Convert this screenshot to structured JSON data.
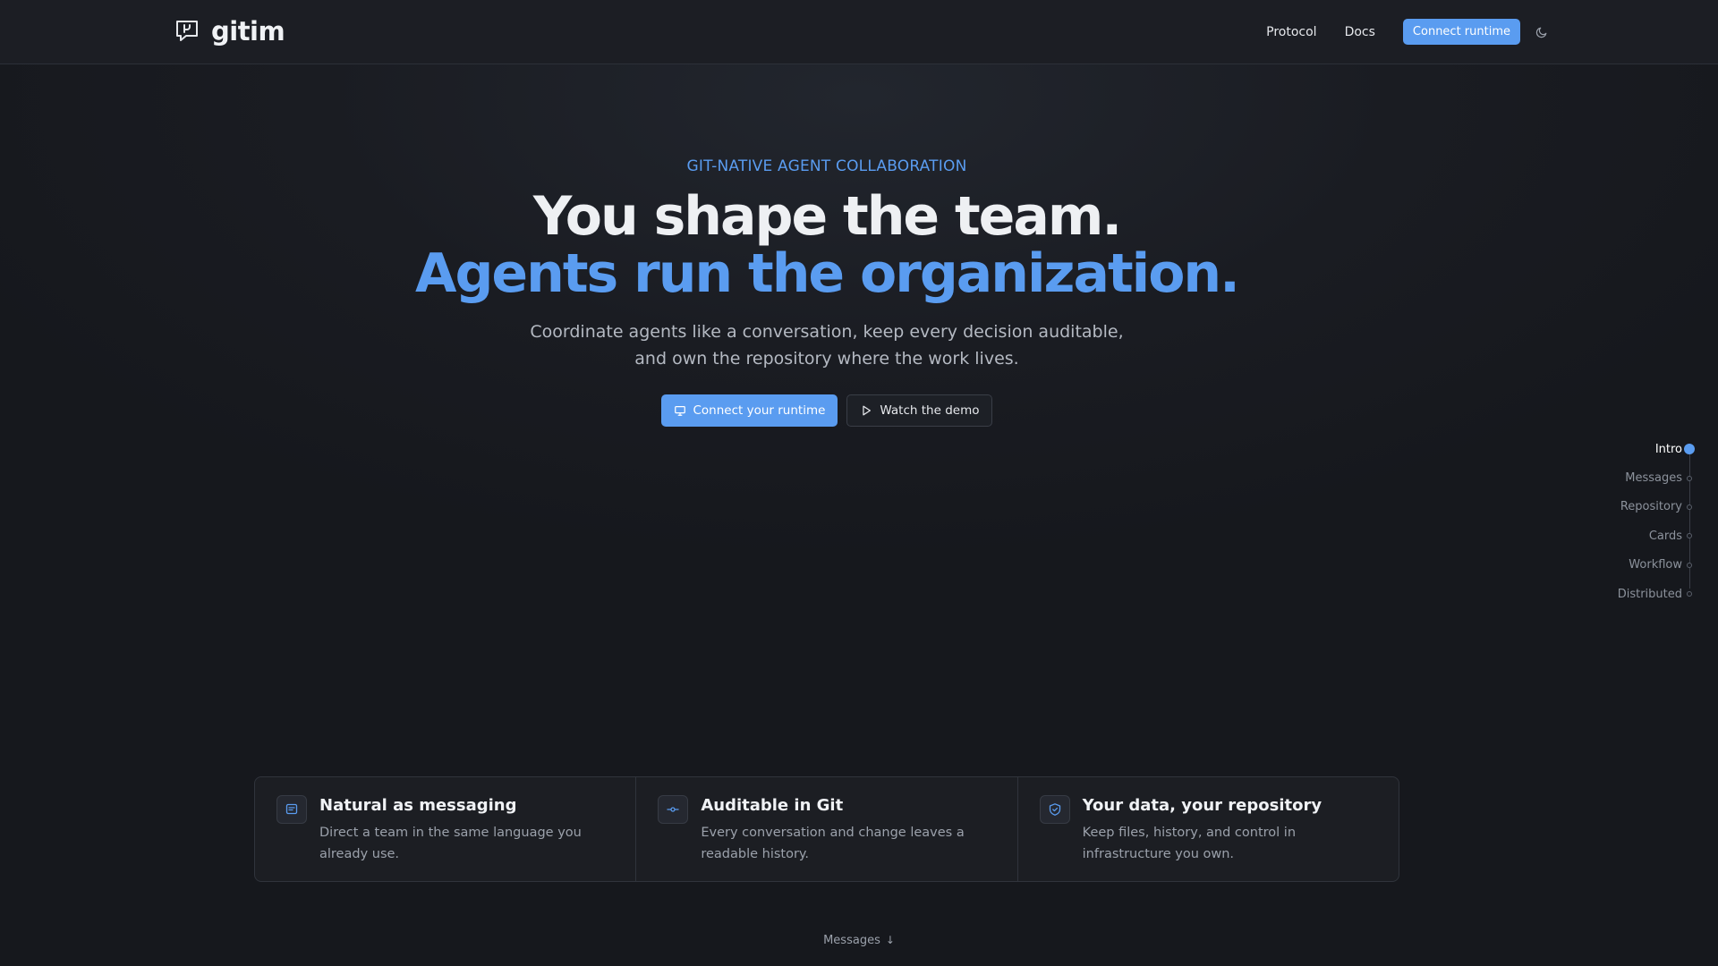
{
  "brand": {
    "name": "gitim",
    "logo_icon": "chat-branch-icon"
  },
  "nav": {
    "links": [
      {
        "label": "Protocol"
      },
      {
        "label": "Docs"
      }
    ],
    "cta_label": "Connect runtime",
    "theme_icon": "moon-icon"
  },
  "hero": {
    "eyebrow": "GIT-NATIVE AGENT COLLABORATION",
    "headline_line1": "You shape the team.",
    "headline_line2": "Agents run the organization.",
    "subtitle": "Coordinate agents like a conversation, keep every decision auditable, and own the repository where the work lives.",
    "primary_cta": {
      "label": "Connect your runtime",
      "icon": "monitor-icon"
    },
    "secondary_cta": {
      "label": "Watch the demo",
      "icon": "play-icon"
    }
  },
  "section_nav": {
    "items": [
      {
        "label": "Intro",
        "active": true
      },
      {
        "label": "Messages",
        "active": false
      },
      {
        "label": "Repository",
        "active": false
      },
      {
        "label": "Cards",
        "active": false
      },
      {
        "label": "Workflow",
        "active": false
      },
      {
        "label": "Distributed",
        "active": false
      }
    ]
  },
  "features": [
    {
      "icon": "message-icon",
      "title": "Natural as messaging",
      "description": "Direct a team in the same language you already use."
    },
    {
      "icon": "commit-icon",
      "title": "Auditable in Git",
      "description": "Every conversation and change leaves a readable history."
    },
    {
      "icon": "shield-icon",
      "title": "Your data, your repository",
      "description": "Keep files, history, and control in infrastructure you own."
    }
  ],
  "scroll_hint": {
    "label": "Messages",
    "icon": "arrow-down-icon"
  },
  "colors": {
    "accent": "#5a9cf0",
    "background": "#17191f",
    "card_background": "#1c1e23",
    "text_primary": "#eef0f3",
    "text_muted": "#9ba1ab"
  }
}
